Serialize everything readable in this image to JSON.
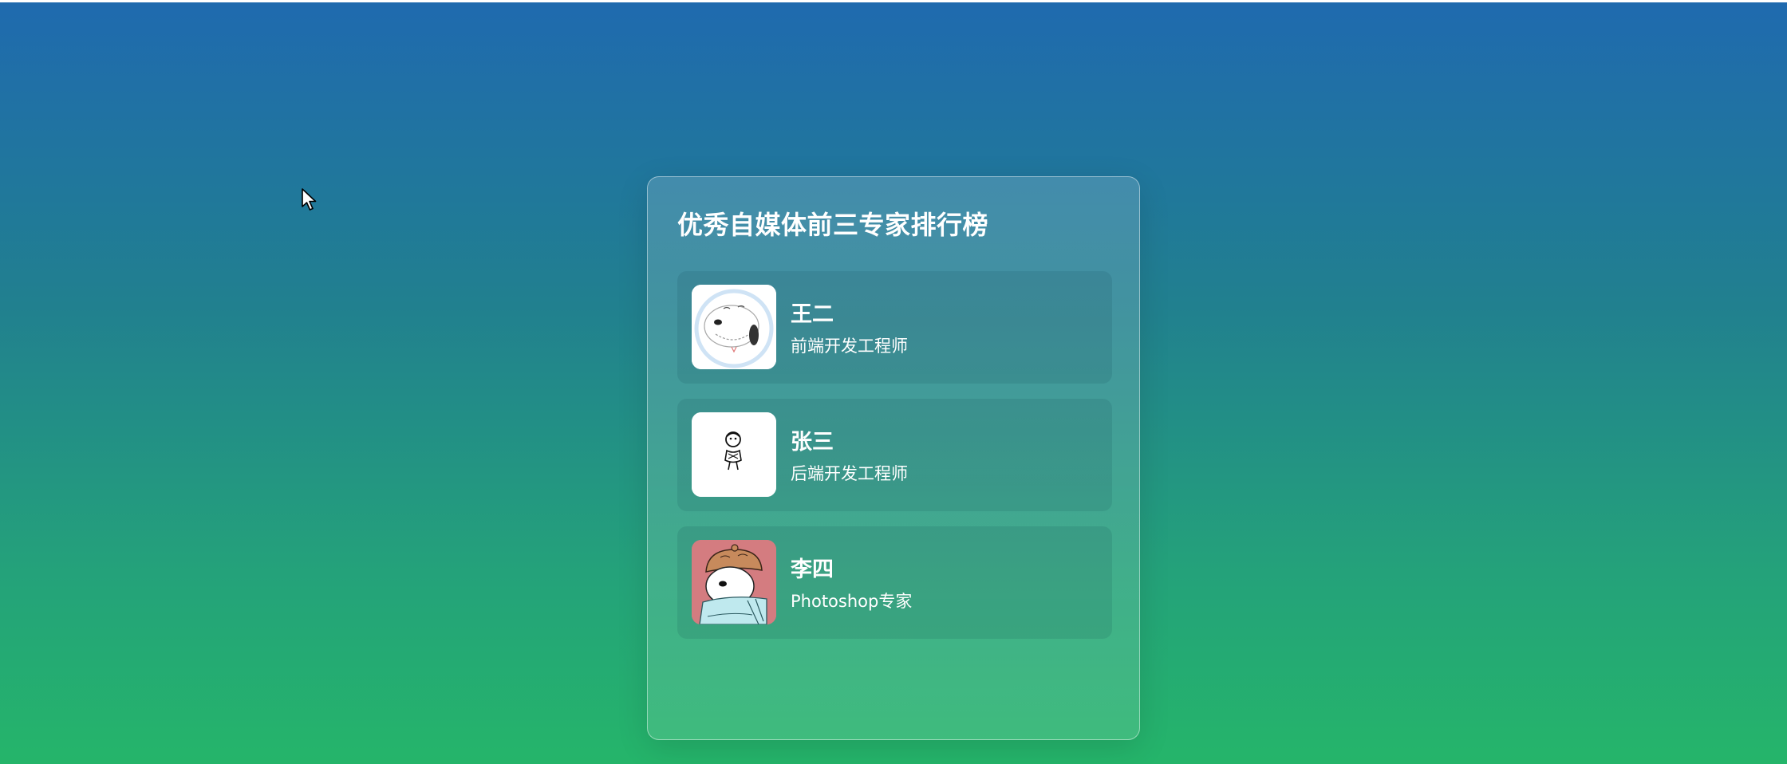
{
  "page": {
    "background_top": "#1f6aaf",
    "background_bottom": "#25b56a"
  },
  "card": {
    "title": "优秀自媒体前三专家排行榜"
  },
  "experts": [
    {
      "name": "王二",
      "role": "前端开发工程师",
      "avatar_icon": "snoopy-avatar-icon"
    },
    {
      "name": "张三",
      "role": "后端开发工程师",
      "avatar_icon": "sketch-character-avatar-icon"
    },
    {
      "name": "李四",
      "role": "Photoshop专家",
      "avatar_icon": "bear-with-cap-avatar-icon",
      "avatar_bg": "#d47c80"
    }
  ]
}
